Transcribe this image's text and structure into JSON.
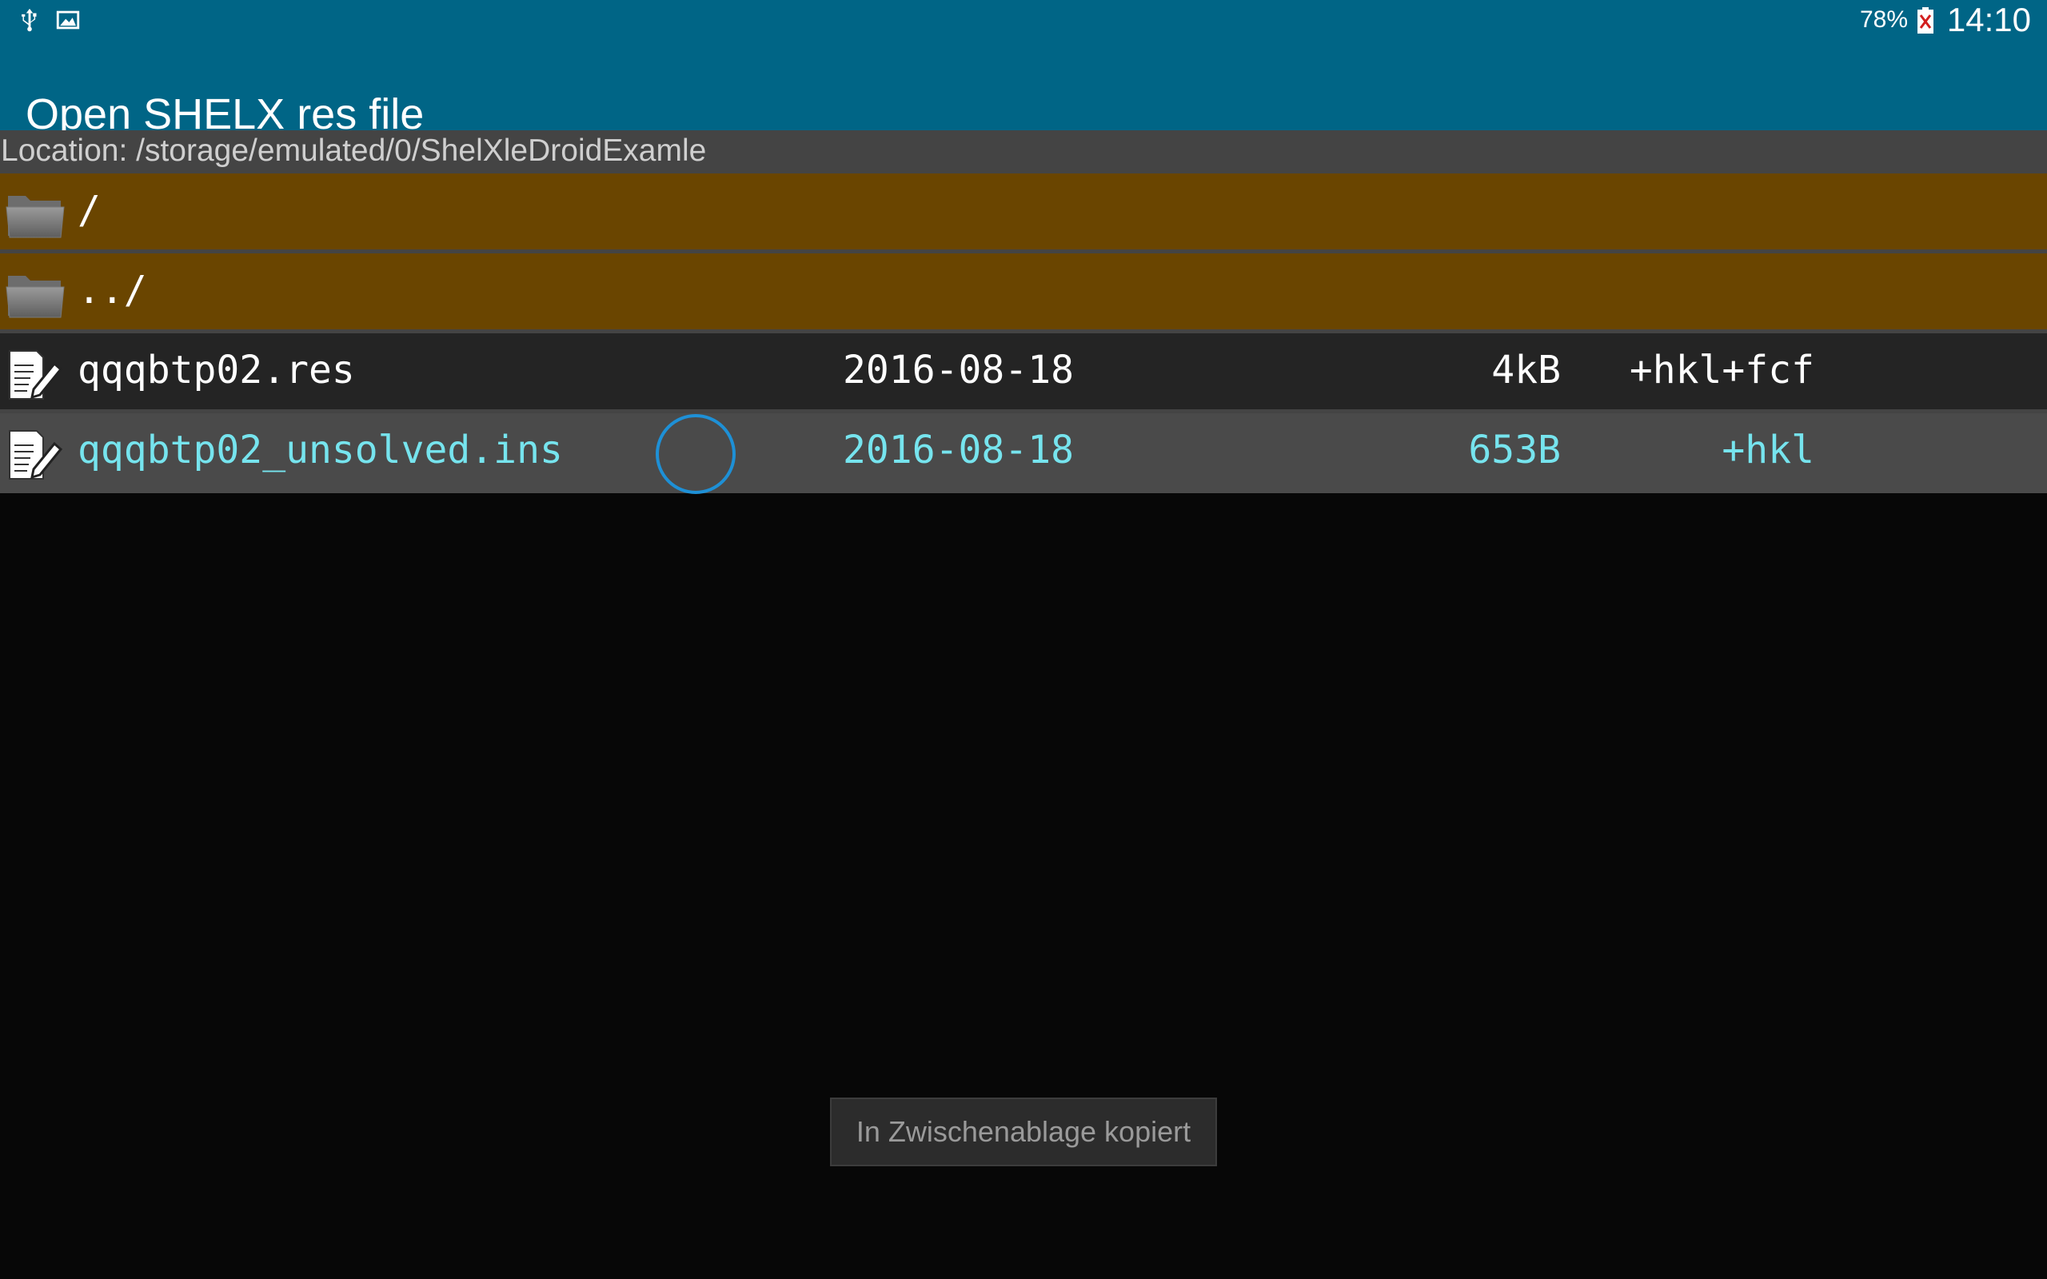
{
  "status_bar": {
    "battery_percent": "78%",
    "time": "14:10",
    "icons": [
      "usb-icon",
      "image-notification-icon",
      "battery-icon"
    ]
  },
  "action_bar": {
    "title": "Open SHELX res file"
  },
  "location": {
    "text": "Location: /storage/emulated/0/ShelXleDroidExamle"
  },
  "directories": [
    {
      "name": "/",
      "icon": "folder-icon"
    },
    {
      "name": "../",
      "icon": "folder-icon"
    }
  ],
  "files": [
    {
      "name": "qqqbtp02.res",
      "date": "2016-08-18",
      "size": "4kB",
      "extra": "+hkl+fcf",
      "icon": "edit-document-icon",
      "selected": false
    },
    {
      "name": "qqqbtp02_unsolved.ins",
      "date": "2016-08-18",
      "size": "653B",
      "extra": "+hkl",
      "icon": "edit-document-icon",
      "selected": true
    }
  ],
  "toast": {
    "text": "In Zwischenablage kopiert"
  },
  "colors": {
    "bar": "#006586",
    "directory_row": "#6a4500",
    "file_row": "#242424",
    "selected_row": "#4a4a4a",
    "selected_text": "#76e4ee",
    "touch_ring": "#1e90d6"
  }
}
